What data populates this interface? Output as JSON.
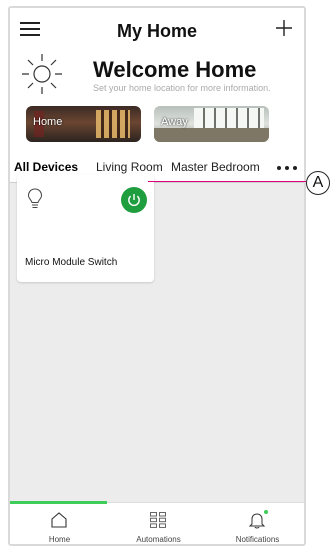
{
  "header": {
    "title": "My Home",
    "welcome_title": "Welcome Home",
    "welcome_subtitle": "Set your home location for more information."
  },
  "scenes": [
    {
      "label": "Home"
    },
    {
      "label": "Away"
    }
  ],
  "tabs": [
    {
      "label": "All Devices",
      "active": true
    },
    {
      "label": "Living Room"
    },
    {
      "label": "Master Bedroom"
    }
  ],
  "devices": [
    {
      "name": "Micro Module Switch",
      "icon": "bulb-icon",
      "power": "on"
    }
  ],
  "callout": {
    "letter": "A"
  },
  "nav": {
    "items": [
      {
        "label": "Home",
        "icon": "home-icon",
        "active": true
      },
      {
        "label": "Automations",
        "icon": "grid-icon"
      },
      {
        "label": "Notifications",
        "icon": "bell-icon"
      }
    ]
  },
  "colors": {
    "accent": "#3dcd58",
    "power_on": "#1f9e3f",
    "callout_line": "#e0007a"
  }
}
